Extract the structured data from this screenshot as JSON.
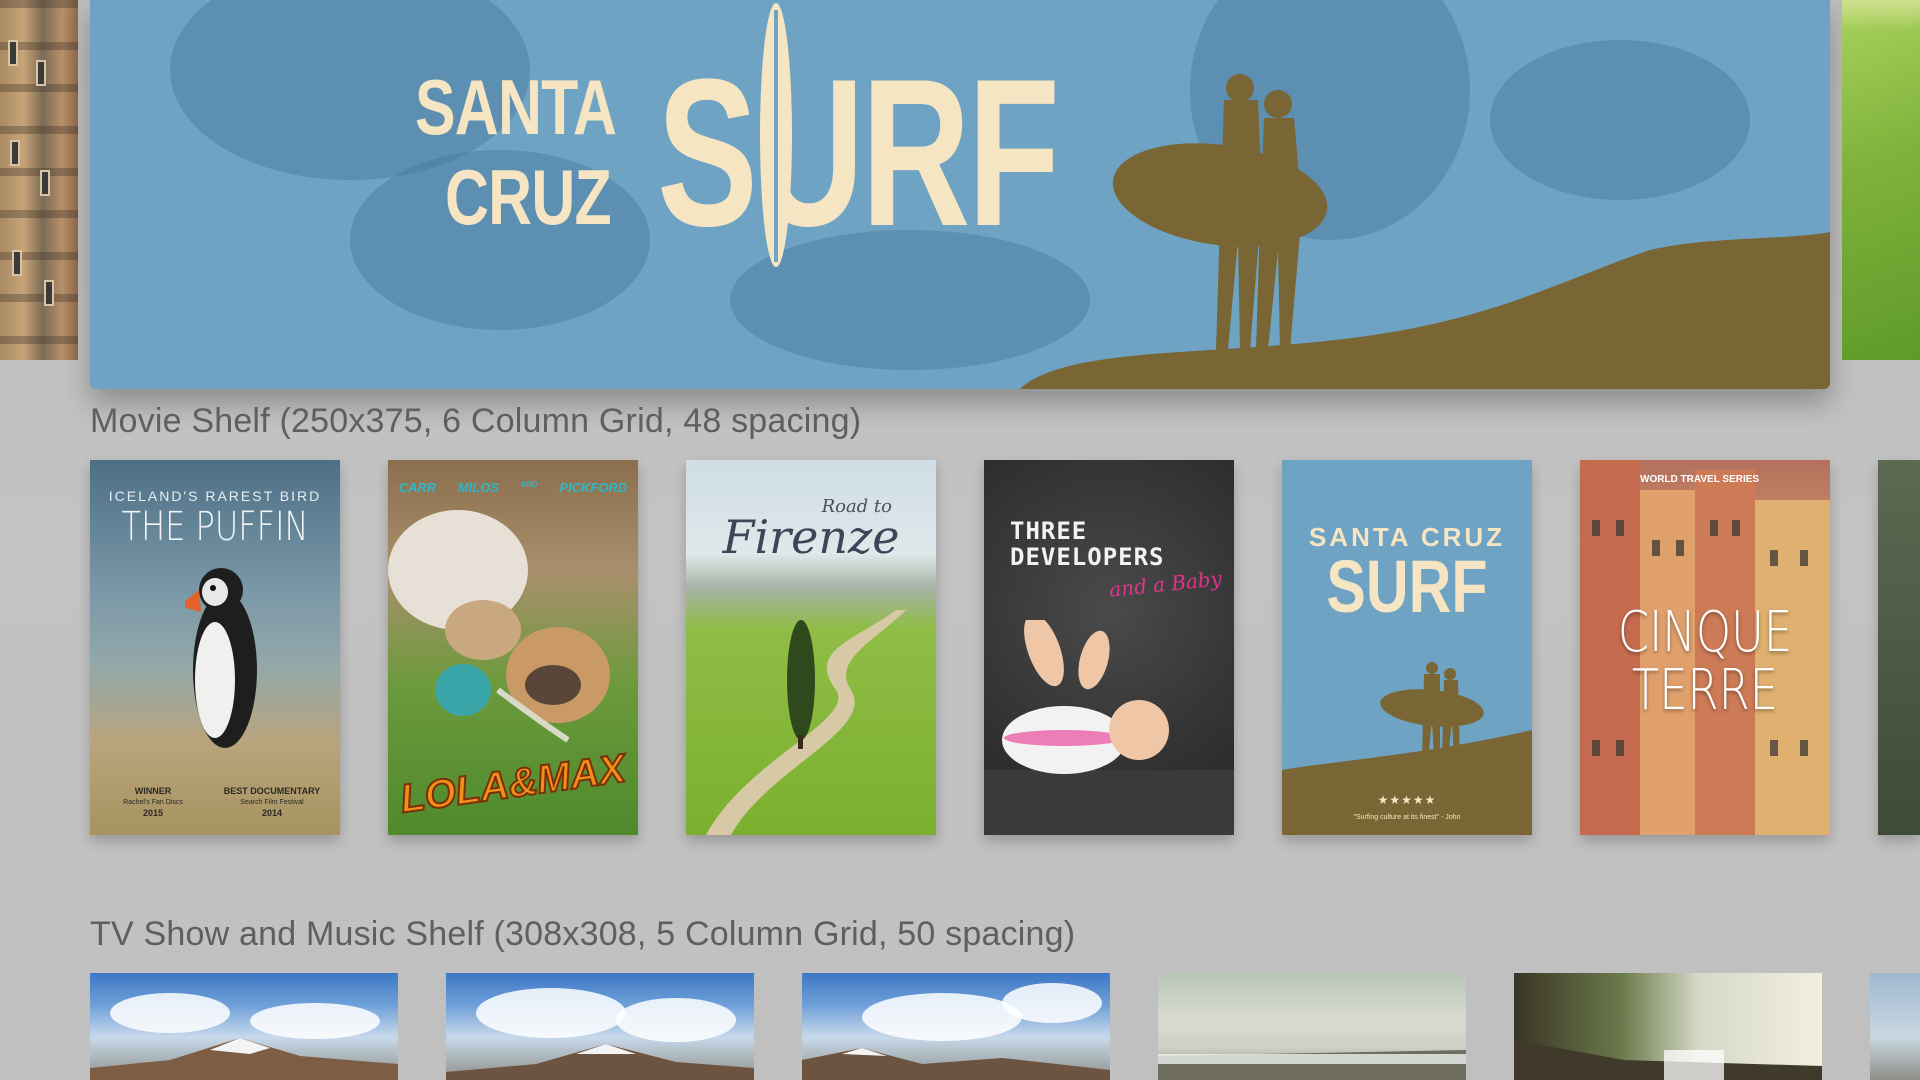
{
  "hero": {
    "title_line1": "SANTA",
    "title_line2": "CRUZ",
    "title_main": "SURF"
  },
  "movie_shelf": {
    "label": "Movie Shelf (250x375, 6 Column Grid, 48 spacing)",
    "posters": [
      {
        "kicker": "ICELAND'S RAREST BIRD",
        "title": "THE PUFFIN",
        "award1_top": "WINNER",
        "award1_mid": "Rachel's Fan Discs",
        "award1_year": "2015",
        "award2_top": "BEST DOCUMENTARY",
        "award2_mid": "Search Film Festival",
        "award2_year": "2014"
      },
      {
        "credits": [
          "CARR",
          "MILOS",
          "AND",
          "PICKFORD"
        ],
        "title": "LOLA&MAX"
      },
      {
        "kicker": "Road to",
        "title": "Firenze"
      },
      {
        "title": "THREE DEVELOPERS",
        "subtitle": "and a Baby"
      },
      {
        "title_line1": "SANTA CRUZ",
        "title": "SURF",
        "stars": "★★★★★",
        "quote": "\"Surfing culture at its finest\" - John"
      },
      {
        "kicker": "WORLD TRAVEL SERIES",
        "title_line1": "CINQUE",
        "title_line2": "TERRE"
      }
    ]
  },
  "tv_shelf": {
    "label": "TV Show and Music Shelf (308x308, 5 Column Grid, 50 spacing)"
  },
  "colors": {
    "background": "#c0c0c0",
    "label_text": "#5f5f5f",
    "surf_sky": "#6ea3c3",
    "surf_cream": "#f6e5c2",
    "surf_silhouette": "#7a6535"
  }
}
